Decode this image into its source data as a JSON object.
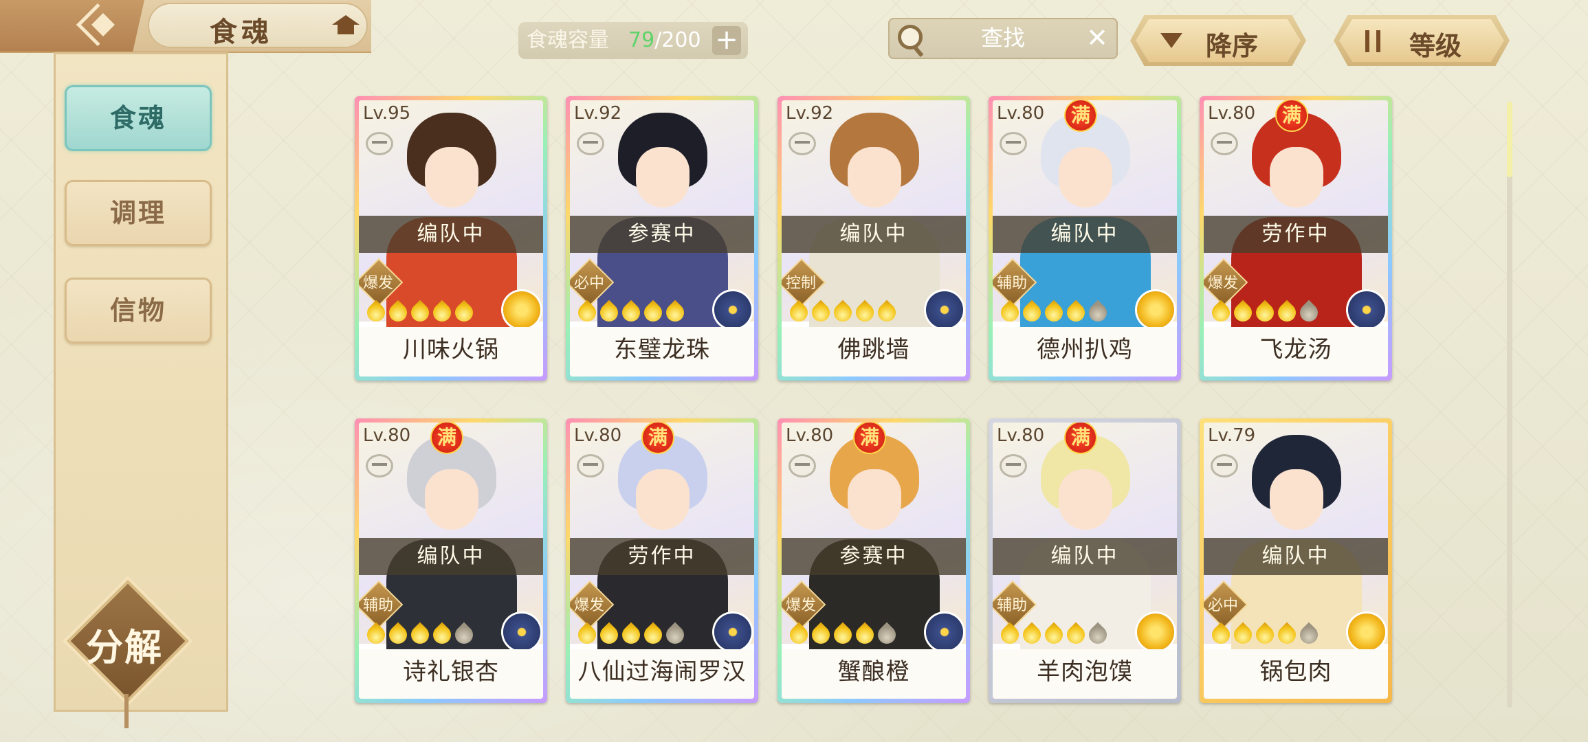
{
  "header": {
    "title": "食魂",
    "capacity_label": "食魂容量",
    "capacity_current": "79",
    "capacity_max": "/200",
    "capacity_add": "+",
    "search_label": "查找",
    "search_clear": "✕",
    "sort_order_label": "降序",
    "sort_key_label": "等级"
  },
  "sidebar": {
    "items": [
      {
        "label": "食魂",
        "active": true
      },
      {
        "label": "调理",
        "active": false
      },
      {
        "label": "信物",
        "active": false
      }
    ],
    "decompose_label": "分解"
  },
  "scroll_progress": 0.0,
  "cards": [
    {
      "level": "Lv.95",
      "maxed": false,
      "status": "编队中",
      "role": "爆发",
      "stars": 5,
      "stars_max": 5,
      "element": "gold",
      "name": "川味火锅",
      "palette": [
        "#4a2f1e",
        "#d94a2a"
      ]
    },
    {
      "level": "Lv.92",
      "maxed": false,
      "status": "参赛中",
      "role": "必中",
      "stars": 5,
      "stars_max": 5,
      "element": "blue",
      "name": "东璧龙珠",
      "palette": [
        "#1e1e28",
        "#4a4f8a"
      ]
    },
    {
      "level": "Lv.92",
      "maxed": false,
      "status": "编队中",
      "role": "控制",
      "stars": 5,
      "stars_max": 5,
      "element": "blue",
      "name": "佛跳墙",
      "palette": [
        "#b4783e",
        "#e8e3d2"
      ]
    },
    {
      "level": "Lv.80",
      "maxed": true,
      "status": "编队中",
      "role": "辅助",
      "stars": 4,
      "stars_max": 5,
      "element": "gold",
      "name": "德州扒鸡",
      "palette": [
        "#dfe4ee",
        "#3aa0d8"
      ]
    },
    {
      "level": "Lv.80",
      "maxed": true,
      "status": "劳作中",
      "role": "爆发",
      "stars": 4,
      "stars_max": 5,
      "element": "blue",
      "name": "飞龙汤",
      "palette": [
        "#c8301e",
        "#b8241a"
      ]
    },
    {
      "level": "Lv.80",
      "maxed": true,
      "status": "编队中",
      "role": "辅助",
      "stars": 4,
      "stars_max": 5,
      "element": "blue",
      "name": "诗礼银杏",
      "palette": [
        "#cfcfd6",
        "#2e3038"
      ]
    },
    {
      "level": "Lv.80",
      "maxed": true,
      "status": "劳作中",
      "role": "爆发",
      "stars": 4,
      "stars_max": 5,
      "element": "blue",
      "name": "八仙过海闹罗汉",
      "palette": [
        "#c9d0ee",
        "#2a2a2e"
      ]
    },
    {
      "level": "Lv.80",
      "maxed": true,
      "status": "参赛中",
      "role": "爆发",
      "stars": 4,
      "stars_max": 5,
      "element": "blue",
      "name": "蟹酿橙",
      "palette": [
        "#e8a64a",
        "#2b2a26"
      ]
    },
    {
      "level": "Lv.80",
      "maxed": true,
      "status": "编队中",
      "role": "辅助",
      "stars": 4,
      "stars_max": 5,
      "element": "gold",
      "name": "羊肉泡馍",
      "palette": [
        "#f0e6a6",
        "#f2eee6"
      ]
    },
    {
      "level": "Lv.79",
      "maxed": false,
      "status": "编队中",
      "role": "必中",
      "stars": 4,
      "stars_max": 5,
      "element": "gold",
      "name": "锅包肉",
      "palette": [
        "#1f2638",
        "#f4e3b8"
      ]
    }
  ],
  "maxed_label": "满",
  "colors": {
    "accent_teal": "#9ed6cf",
    "gold_brown": "#7a4f27",
    "capacity_green": "#5fd36a"
  }
}
